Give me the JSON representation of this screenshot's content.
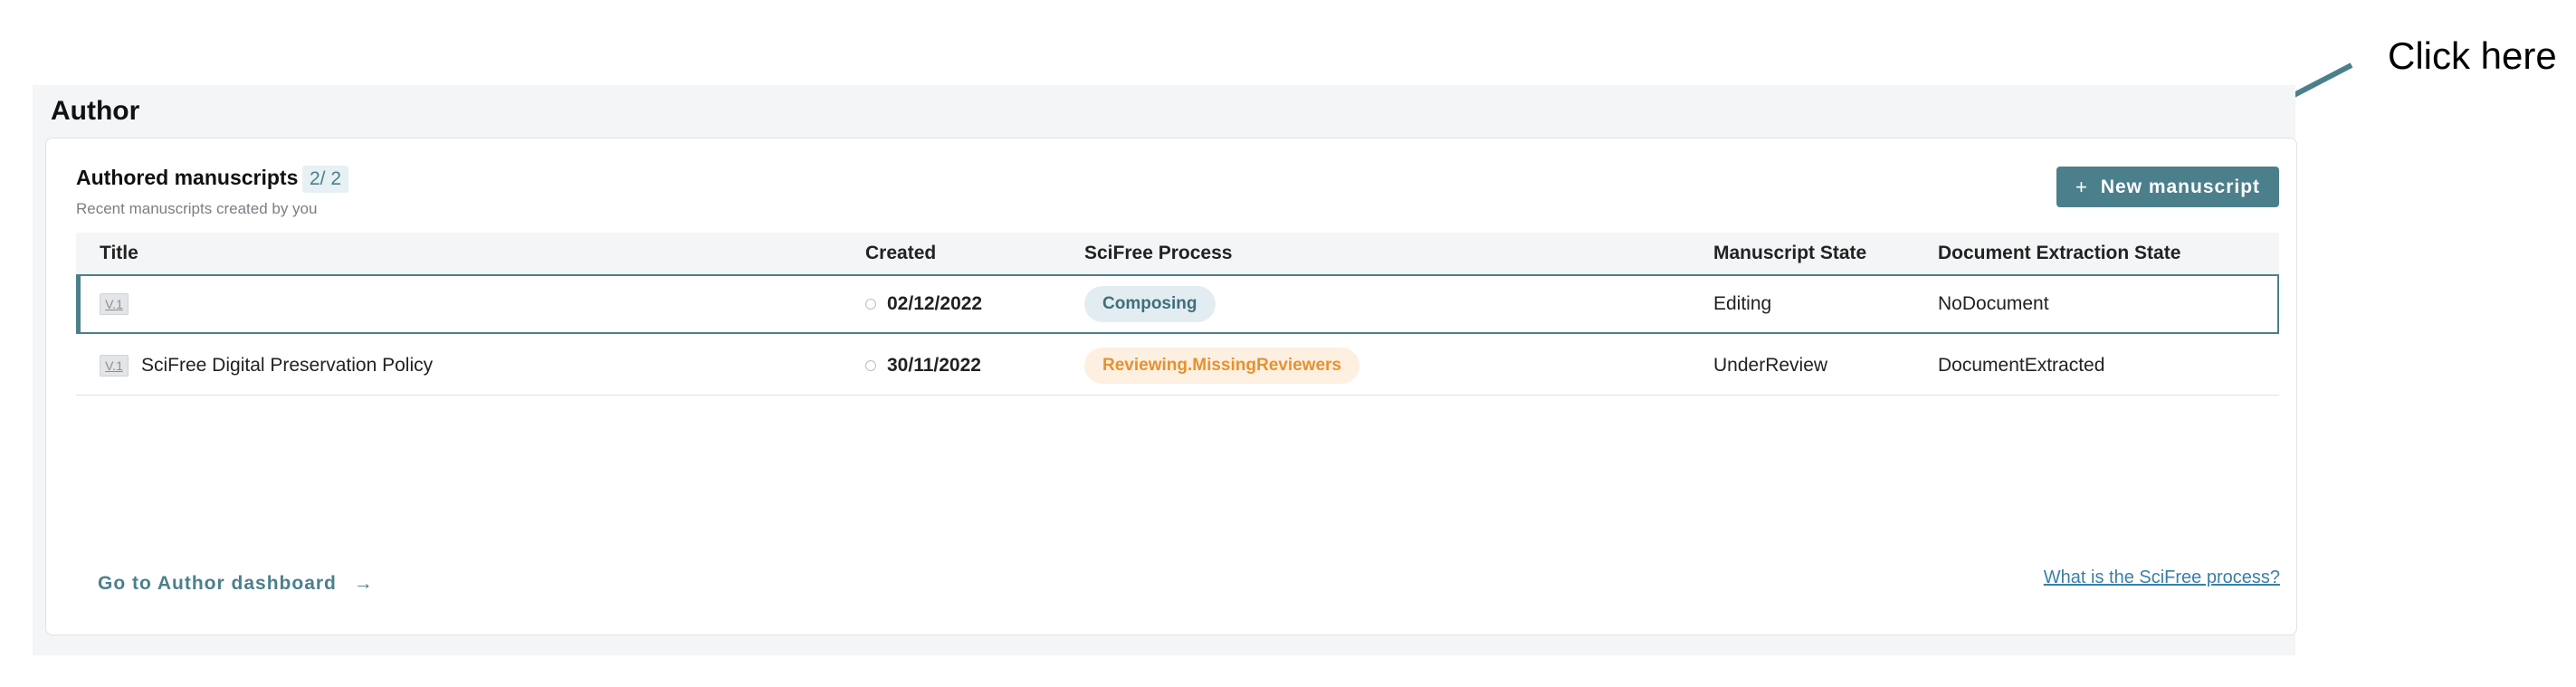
{
  "annotation": {
    "text": "Click here"
  },
  "section": {
    "title": "Author"
  },
  "card": {
    "title": "Authored manuscripts",
    "count": "2/ 2",
    "subtitle": "Recent manuscripts created by you",
    "new_button_icon": "+",
    "new_button_label": "New manuscript"
  },
  "table": {
    "headers": [
      "Title",
      "Created",
      "SciFree Process",
      "Manuscript State",
      "Document Extraction State"
    ],
    "rows": [
      {
        "version": "V.1",
        "title": "",
        "created": "02/12/2022",
        "process": "Composing",
        "state": "Editing",
        "extraction": "NoDocument"
      },
      {
        "version": "V.1",
        "title": "SciFree Digital Preservation Policy",
        "created": "30/11/2022",
        "process": "Reviewing.MissingReviewers",
        "state": "UnderReview",
        "extraction": "DocumentExtracted"
      }
    ]
  },
  "footer": {
    "dashboard_link": "Go to Author dashboard",
    "dashboard_arrow": "→",
    "help_link": "What is the SciFree process?"
  },
  "colors": {
    "accent": "#4b7f8c",
    "process_blue_bg": "#e3edf1",
    "process_orange": "#e8912d",
    "link": "#3a7fa8"
  },
  "icons": {
    "clock": "clock-icon",
    "plus": "plus-icon",
    "arrow_right": "arrow-right-icon"
  }
}
